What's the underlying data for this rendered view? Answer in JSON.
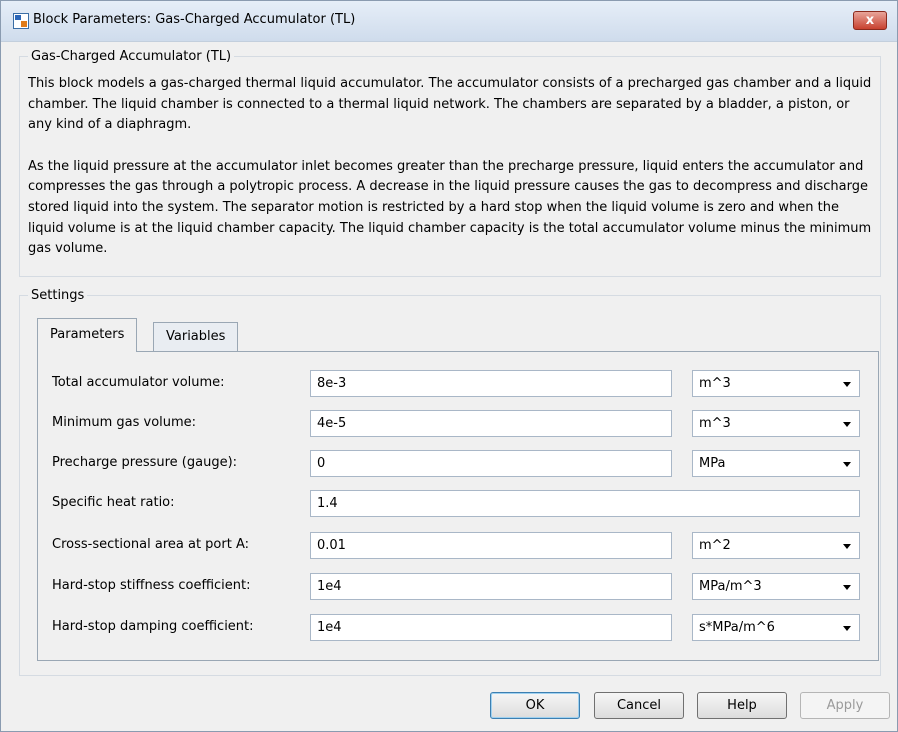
{
  "window": {
    "title": "Block Parameters: Gas-Charged Accumulator (TL)",
    "close_symbol": "x"
  },
  "description": {
    "legend": "Gas-Charged Accumulator (TL)",
    "paragraphs": [
      "This block models a gas-charged thermal liquid accumulator. The accumulator consists of a precharged gas chamber and a liquid chamber. The liquid chamber is connected to a thermal liquid network. The chambers are separated by a bladder, a piston, or any kind of a diaphragm.",
      "As the liquid pressure at the accumulator inlet becomes greater than the precharge pressure, liquid enters the accumulator and compresses the gas through a polytropic process. A decrease in the liquid pressure causes the gas to decompress and discharge stored liquid into the system. The separator motion is restricted by a hard stop when the liquid volume is zero and when the liquid volume is at the liquid chamber capacity. The liquid chamber capacity is the total accumulator volume minus the minimum gas volume."
    ]
  },
  "settings": {
    "legend": "Settings",
    "tabs": [
      "Parameters",
      "Variables"
    ],
    "active_tab": "Parameters",
    "parameters": [
      {
        "label": "Total accumulator volume:",
        "value": "8e-3",
        "unit": "m^3"
      },
      {
        "label": "Minimum gas volume:",
        "value": "4e-5",
        "unit": "m^3"
      },
      {
        "label": "Precharge pressure (gauge):",
        "value": "0",
        "unit": "MPa"
      },
      {
        "label": "Specific heat ratio:",
        "value": "1.4",
        "unit": null
      },
      {
        "label": "Cross-sectional area at port A:",
        "value": "0.01",
        "unit": "m^2"
      },
      {
        "label": "Hard-stop stiffness coefficient:",
        "value": "1e4",
        "unit": "MPa/m^3"
      },
      {
        "label": "Hard-stop damping coefficient:",
        "value": "1e4",
        "unit": "s*MPa/m^6"
      }
    ]
  },
  "buttons": {
    "ok": "OK",
    "cancel": "Cancel",
    "help": "Help",
    "apply": "Apply"
  },
  "colors": {
    "window_bg": "#f0f0f0",
    "close_button": "#c8412f",
    "field_border": "#a9b7c7"
  }
}
